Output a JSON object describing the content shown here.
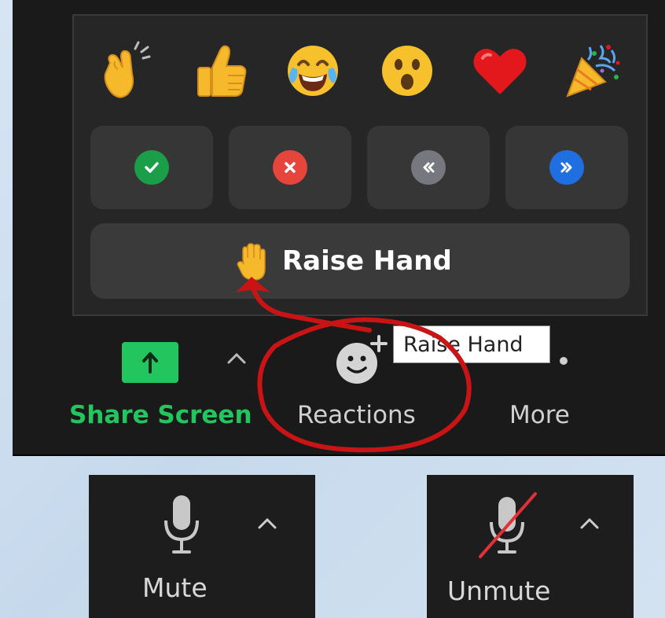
{
  "reactions": {
    "emojis": [
      {
        "name": "clapping-hands"
      },
      {
        "name": "thumbs-up"
      },
      {
        "name": "tears-of-joy"
      },
      {
        "name": "surprised-face"
      },
      {
        "name": "red-heart"
      },
      {
        "name": "party-popper"
      }
    ],
    "feedback": [
      {
        "name": "yes",
        "icon": "check-icon",
        "color": "#1a9e48"
      },
      {
        "name": "no",
        "icon": "x-icon",
        "color": "#e5453a"
      },
      {
        "name": "go-slower",
        "icon": "rewind-icon",
        "color": "#77777f"
      },
      {
        "name": "go-faster",
        "icon": "fast-forward-icon",
        "color": "#1f6fe0"
      }
    ],
    "raise_hand_label": "Raise Hand"
  },
  "toolbar": {
    "share_screen_label": "Share Screen",
    "reactions_label": "Reactions",
    "more_label": "More",
    "tooltip": "Raise Hand",
    "share_color": "#22c55e"
  },
  "audio": {
    "mute_label": "Mute",
    "unmute_label": "Unmute"
  },
  "annotation": {
    "color": "#c81414"
  }
}
